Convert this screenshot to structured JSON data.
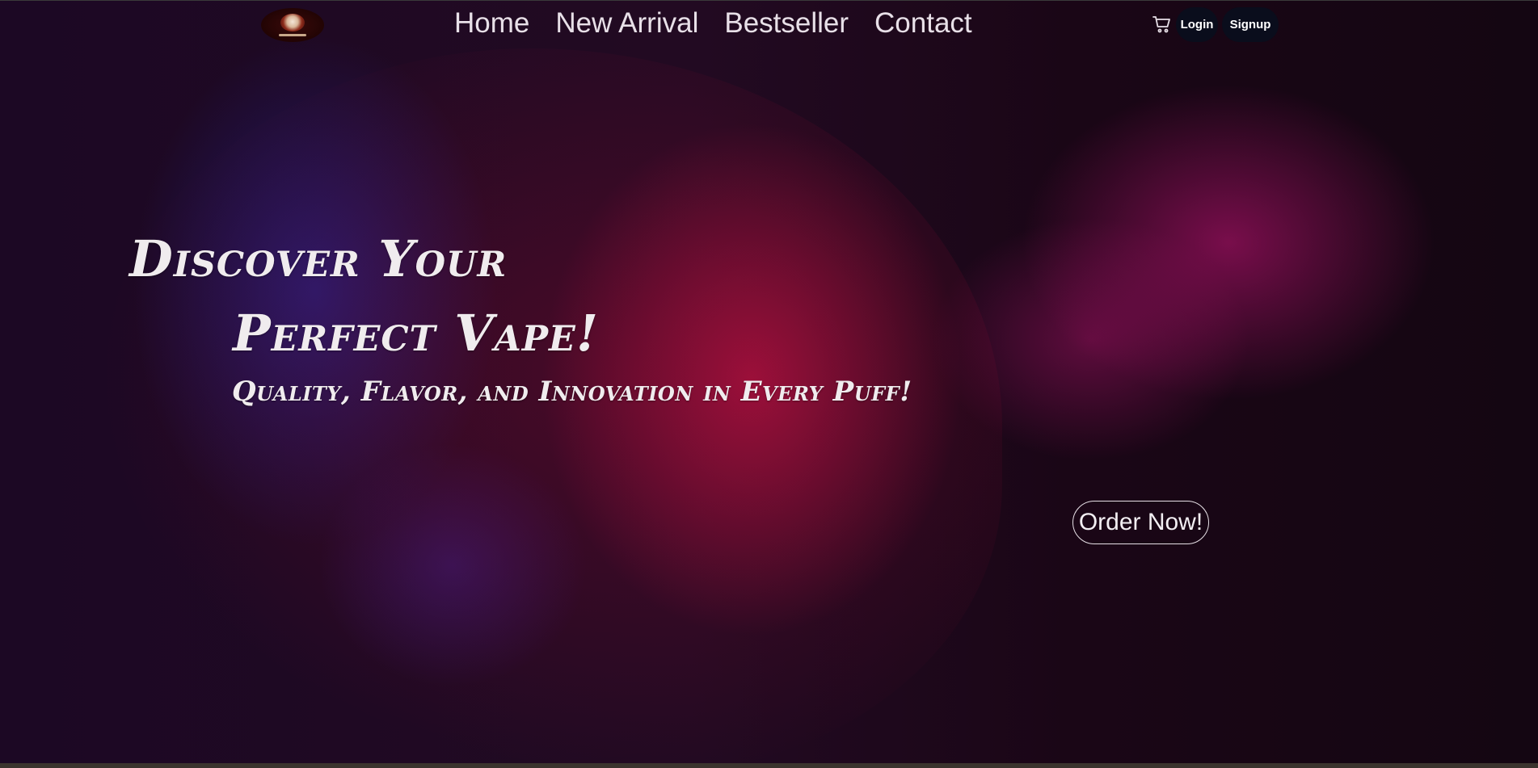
{
  "header": {
    "logo_icon": "shop-logo",
    "nav": [
      {
        "label": "Home"
      },
      {
        "label": "New Arrival"
      },
      {
        "label": "Bestseller"
      },
      {
        "label": "Contact"
      }
    ],
    "cart_icon": "cart-icon",
    "login_label": "Login",
    "signup_label": "Signup"
  },
  "hero": {
    "headline_line1": "Discover Your",
    "headline_line2": "Perfect Vape!",
    "subheadline": "Quality, Flavor, and Innovation in Every Puff!",
    "cta_label": "Order Now!"
  },
  "colors": {
    "background": "#1a0818",
    "accent_red": "#c81446",
    "accent_blue": "#2828aa",
    "smoke_magenta": "#c8147a",
    "pill_background": "#0a0d1c",
    "text": "#f0ecee"
  }
}
